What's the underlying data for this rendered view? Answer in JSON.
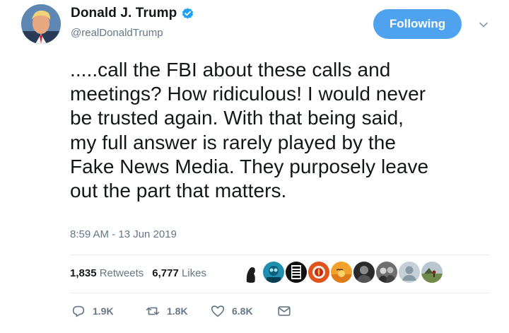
{
  "author": {
    "display_name": "Donald J. Trump",
    "handle": "@realDonaldTrump",
    "verified": true
  },
  "follow_button": {
    "label": "Following"
  },
  "tweet": {
    "text": ".....call the FBI about these calls and\nmeetings? How ridiculous! I would never\nbe trusted again. With that being said,\nmy full answer is rarely played by the\nFake News Media. They purposely leave\nout the part that matters.",
    "timestamp": "8:59 AM - 13 Jun 2019"
  },
  "stats": {
    "retweets_count": "1,835",
    "retweets_label": "Retweets",
    "likes_count": "6,777",
    "likes_label": "Likes"
  },
  "liked_by_avatars": [
    "silhouette-avatar",
    "diver-avatar",
    "no-nothing-logo-avatar",
    "fire-emblem-avatar",
    "sunset-bird-avatar",
    "dark-portrait-avatar",
    "bw-people-avatar",
    "default-user-avatar",
    "landscape-avatar"
  ],
  "actions": {
    "reply_count": "1.9K",
    "retweet_count": "1.8K",
    "like_count": "6.8K"
  },
  "colors": {
    "accent": "#4ea2ee",
    "text_primary": "#14171a",
    "text_secondary": "#657786",
    "divider": "#e6ecf0"
  }
}
